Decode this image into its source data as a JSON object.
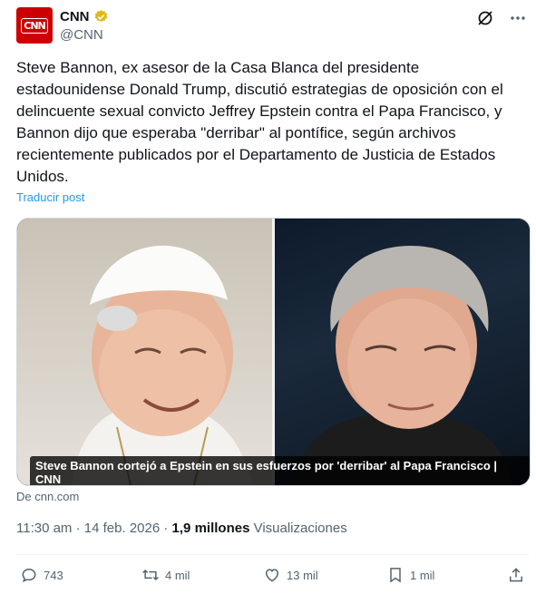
{
  "author": {
    "name": "CNN",
    "handle": "@CNN",
    "avatar_text": "CNN",
    "avatar_color": "#cc0000",
    "verified_color": "#e2b719"
  },
  "header_icons": [
    "grok-slash-icon",
    "more-icon"
  ],
  "tweet": {
    "text": "Steve Bannon, ex asesor de la Casa Blanca del presidente estadounidense Donald Trump, discutió estrategias de oposición con el delincuente sexual convicto Jeffrey Epstein contra el Papa Francisco, y Bannon dijo que esperaba \"derribar\" al pontífice, según archivos recientemente publicados por el Departamento de Justicia de Estados Unidos.",
    "translate_label": "Traducir post"
  },
  "media": {
    "caption": "Steve Bannon cortejó a Epstein en sus esfuerzos por 'derribar' al Papa Francisco | CNN",
    "source_label": "De cnn.com"
  },
  "meta": {
    "time": "11:30 am",
    "separator": "·",
    "date": "14 feb. 2026",
    "views_count": "1,9 millones",
    "views_label": "Visualizaciones"
  },
  "actions": {
    "replies": "743",
    "reposts": "4 mil",
    "likes": "13 mil",
    "bookmarks": "1 mil"
  },
  "colors": {
    "text": "#0f1419",
    "secondary": "#536471",
    "link": "#1d9bf0"
  }
}
